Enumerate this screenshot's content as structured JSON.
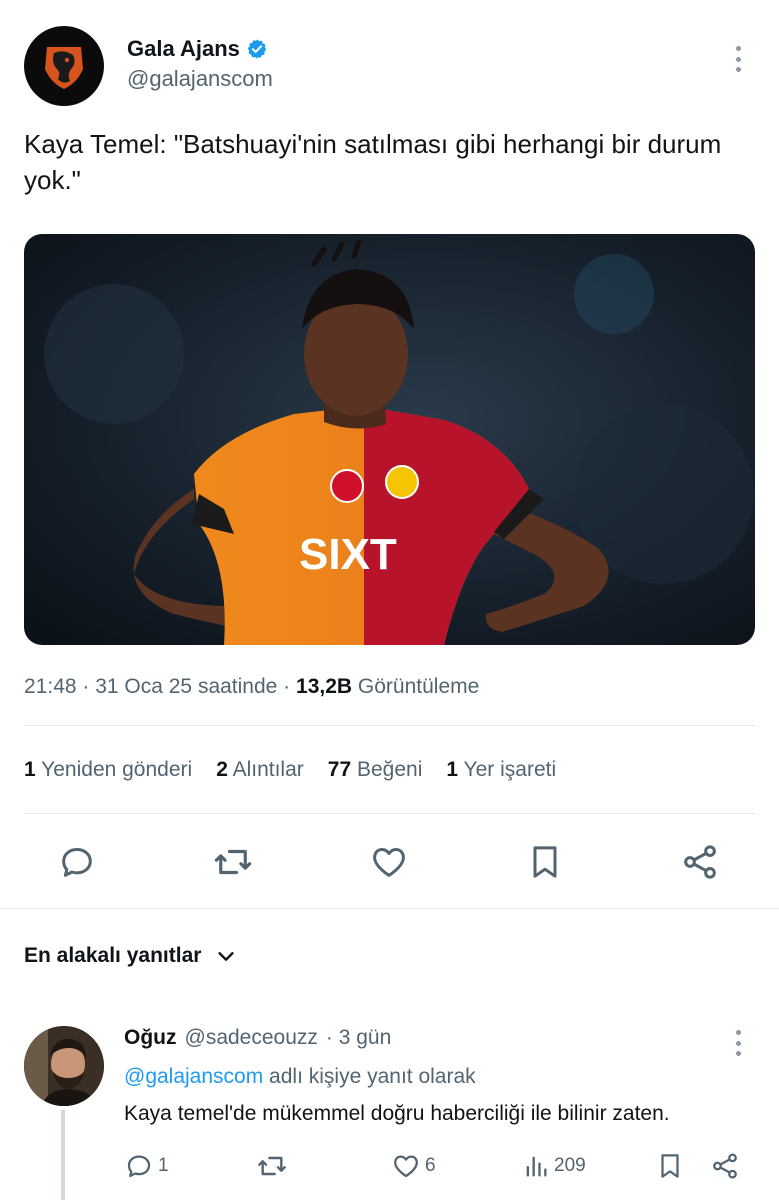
{
  "tweet": {
    "author_name": "Gala Ajans",
    "author_handle": "@galajanscom",
    "text": "Kaya Temel: \"Batshuayi'nin satılması gibi herhangi bir durum yok.\"",
    "time": "21:48 · 31 Oca 25 saatinde · ",
    "views_count": "13,2B",
    "views_label": " Görüntüleme",
    "stats": {
      "reposts_count": "1",
      "reposts_label": "Yeniden gönderi",
      "quotes_count": "2",
      "quotes_label": "Alıntılar",
      "likes_count": "77",
      "likes_label": "Beğeni",
      "bookmarks_count": "1",
      "bookmarks_label": "Yer işareti"
    },
    "actions": [
      "reply-icon",
      "repost-icon",
      "like-icon",
      "bookmark-icon",
      "share-icon"
    ]
  },
  "replies_sort": {
    "label": "En alakalı yanıtlar"
  },
  "reply": {
    "author_name": "Oğuz",
    "author_handle": "@sadeceouzz",
    "time": "· 3 gün",
    "mention": "@galajanscom",
    "reply_to_label": " adlı kişiye yanıt olarak",
    "text": "Kaya temel'de mükemmel doğru haberciliği ile bilinir zaten.",
    "reply_count": "1",
    "like_count": "6",
    "views_count": "209"
  },
  "colors": {
    "accent": "#1d9bf0",
    "secondary_text": "#536471",
    "primary_text": "#0f1419"
  }
}
